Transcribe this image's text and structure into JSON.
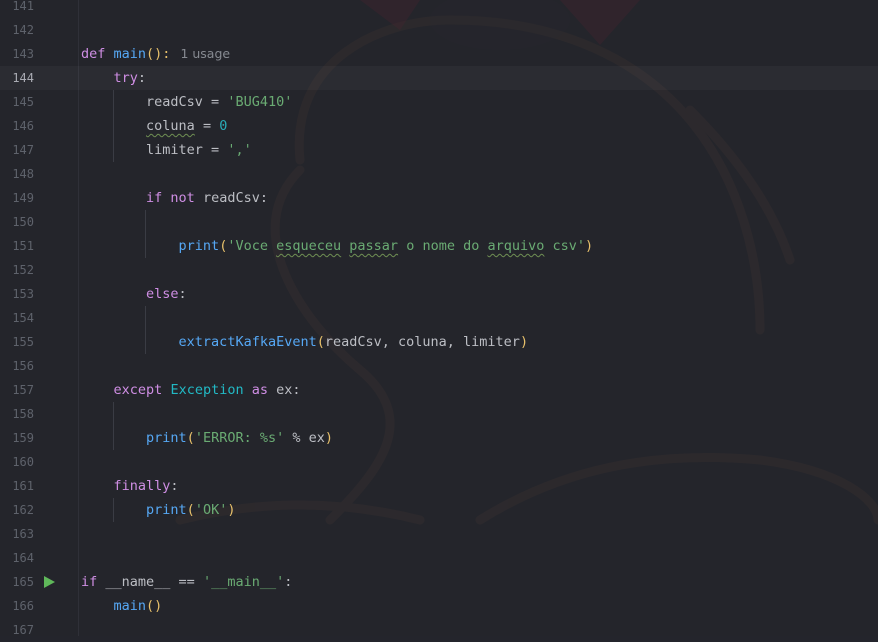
{
  "editor": {
    "lines": [
      {
        "n": "141",
        "tokens": []
      },
      {
        "n": "142",
        "tokens": []
      },
      {
        "n": "143",
        "tokens": [
          {
            "t": "def",
            "c": "kw"
          },
          {
            "t": " "
          },
          {
            "t": "main",
            "c": "fn"
          },
          {
            "t": "():",
            "c": "par"
          }
        ],
        "hint": "1 usage"
      },
      {
        "n": "144",
        "tokens": [
          {
            "t": "    "
          },
          {
            "t": "try",
            "c": "kw"
          },
          {
            "t": ":"
          }
        ],
        "current": true
      },
      {
        "n": "145",
        "tokens": [
          {
            "t": "        readCsv = "
          },
          {
            "t": "'BUG410'",
            "c": "str"
          }
        ]
      },
      {
        "n": "146",
        "tokens": [
          {
            "t": "        "
          },
          {
            "t": "coluna",
            "c": "typo"
          },
          {
            "t": " = "
          },
          {
            "t": "0",
            "c": "num"
          }
        ]
      },
      {
        "n": "147",
        "tokens": [
          {
            "t": "        limiter = "
          },
          {
            "t": "','",
            "c": "str"
          }
        ]
      },
      {
        "n": "148",
        "tokens": []
      },
      {
        "n": "149",
        "tokens": [
          {
            "t": "        "
          },
          {
            "t": "if not",
            "c": "kw"
          },
          {
            "t": " readCsv:"
          }
        ]
      },
      {
        "n": "150",
        "tokens": []
      },
      {
        "n": "151",
        "tokens": [
          {
            "t": "            "
          },
          {
            "t": "print",
            "c": "fn"
          },
          {
            "t": "(",
            "c": "par"
          },
          {
            "t": "'Voce ",
            "c": "str"
          },
          {
            "t": "esqueceu",
            "c": "str typo"
          },
          {
            "t": " ",
            "c": "str"
          },
          {
            "t": "passar",
            "c": "str typo"
          },
          {
            "t": " o nome do ",
            "c": "str"
          },
          {
            "t": "arquivo",
            "c": "str typo"
          },
          {
            "t": " csv'",
            "c": "str"
          },
          {
            "t": ")",
            "c": "par"
          }
        ]
      },
      {
        "n": "152",
        "tokens": []
      },
      {
        "n": "153",
        "tokens": [
          {
            "t": "        "
          },
          {
            "t": "else",
            "c": "kw"
          },
          {
            "t": ":"
          }
        ]
      },
      {
        "n": "154",
        "tokens": []
      },
      {
        "n": "155",
        "tokens": [
          {
            "t": "            "
          },
          {
            "t": "extractKafkaEvent",
            "c": "fn"
          },
          {
            "t": "(",
            "c": "par"
          },
          {
            "t": "readCsv, coluna, limiter"
          },
          {
            "t": ")",
            "c": "par"
          }
        ]
      },
      {
        "n": "156",
        "tokens": []
      },
      {
        "n": "157",
        "tokens": [
          {
            "t": "    "
          },
          {
            "t": "except",
            "c": "kw"
          },
          {
            "t": " "
          },
          {
            "t": "Exception",
            "c": "cls"
          },
          {
            "t": " "
          },
          {
            "t": "as",
            "c": "kw"
          },
          {
            "t": " ex:"
          }
        ]
      },
      {
        "n": "158",
        "tokens": []
      },
      {
        "n": "159",
        "tokens": [
          {
            "t": "        "
          },
          {
            "t": "print",
            "c": "fn"
          },
          {
            "t": "(",
            "c": "par"
          },
          {
            "t": "'ERROR: %s'",
            "c": "str"
          },
          {
            "t": " % ex"
          },
          {
            "t": ")",
            "c": "par"
          }
        ]
      },
      {
        "n": "160",
        "tokens": []
      },
      {
        "n": "161",
        "tokens": [
          {
            "t": "    "
          },
          {
            "t": "finally",
            "c": "kw"
          },
          {
            "t": ":"
          }
        ]
      },
      {
        "n": "162",
        "tokens": [
          {
            "t": "        "
          },
          {
            "t": "print",
            "c": "fn"
          },
          {
            "t": "(",
            "c": "par"
          },
          {
            "t": "'OK'",
            "c": "str"
          },
          {
            "t": ")",
            "c": "par"
          }
        ]
      },
      {
        "n": "163",
        "tokens": []
      },
      {
        "n": "164",
        "tokens": []
      },
      {
        "n": "165",
        "tokens": [
          {
            "t": "if",
            "c": "kw"
          },
          {
            "t": " __name__ == "
          },
          {
            "t": "'__main__'",
            "c": "str"
          },
          {
            "t": ":"
          }
        ],
        "run": true
      },
      {
        "n": "166",
        "tokens": [
          {
            "t": "    "
          },
          {
            "t": "main",
            "c": "fn"
          },
          {
            "t": "()",
            "c": "par"
          }
        ]
      },
      {
        "n": "167",
        "tokens": []
      }
    ]
  },
  "colors": {
    "background": "#24252c",
    "keyword": "#cf8ee4",
    "function": "#56a8f5",
    "string": "#6aab73",
    "number": "#2aacb8",
    "run_marker": "#5fb85a"
  }
}
